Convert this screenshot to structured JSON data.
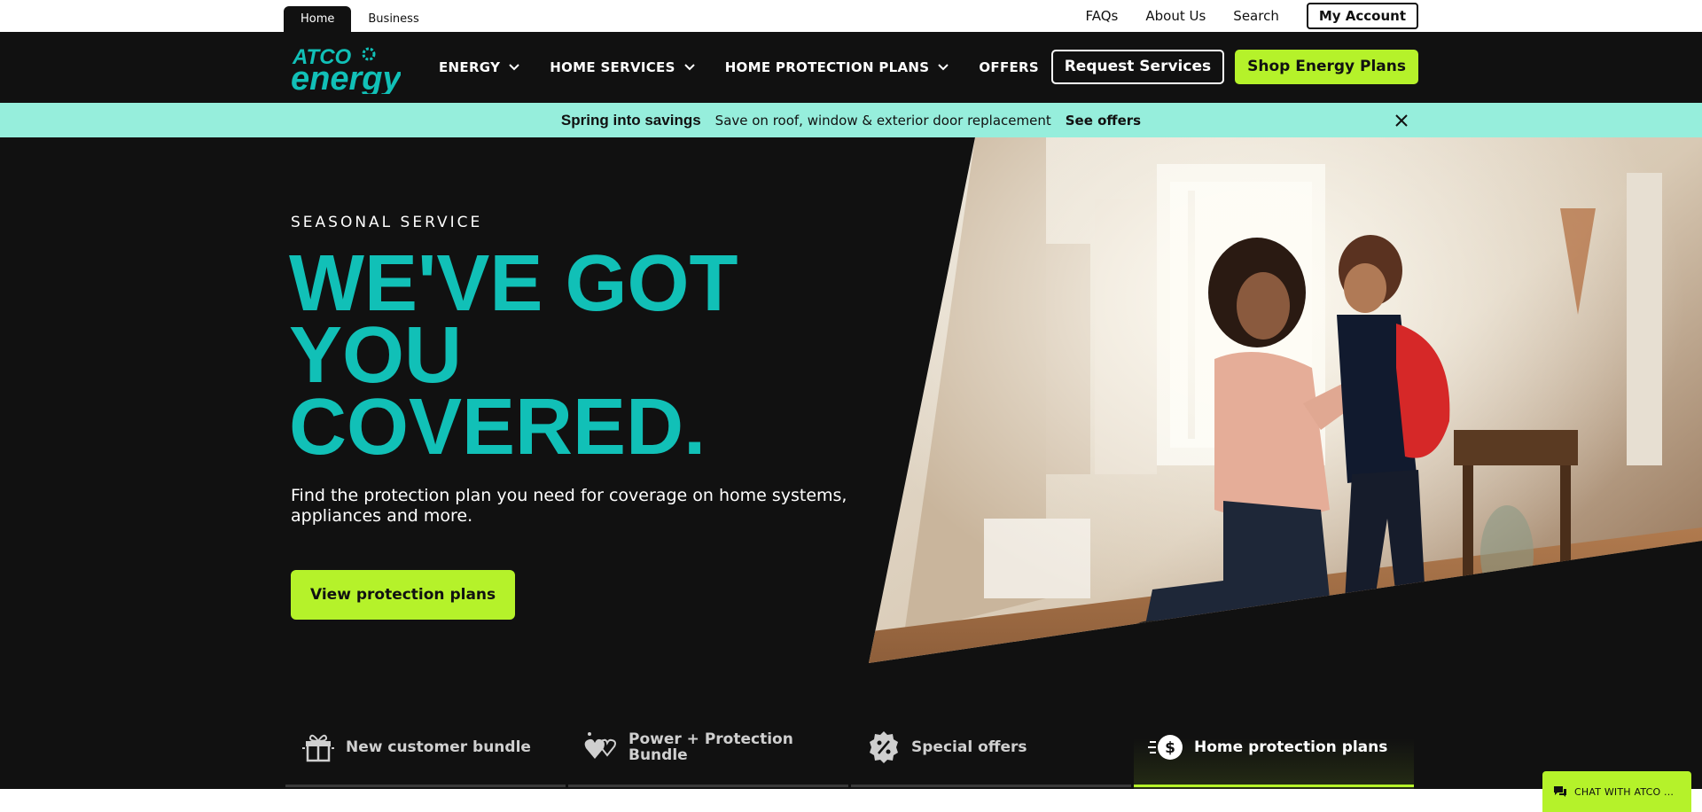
{
  "site_tabs": [
    {
      "label": "Home",
      "active": true
    },
    {
      "label": "Business",
      "active": false
    }
  ],
  "utility_links": [
    "FAQs",
    "About Us",
    "Search"
  ],
  "account_button": "My Account",
  "logo": {
    "line1": "ATCO",
    "line2": "energy"
  },
  "nav": {
    "items": [
      {
        "label": "ENERGY",
        "has_dropdown": true
      },
      {
        "label": "HOME SERVICES",
        "has_dropdown": true
      },
      {
        "label": "HOME PROTECTION PLANS",
        "has_dropdown": true
      },
      {
        "label": "OFFERS",
        "has_dropdown": false
      }
    ],
    "request_button": "Request Services",
    "shop_button": "Shop Energy Plans"
  },
  "promo": {
    "title": "Spring into savings",
    "text": "Save on roof, window & exterior door replacement",
    "link": "See offers",
    "close_icon": "close-icon"
  },
  "hero": {
    "eyebrow": "SEASONAL SERVICE",
    "headline": [
      "WE'VE GOT",
      "YOU",
      "COVERED."
    ],
    "subtitle": "Find the protection plan you need for coverage on home systems, appliances and more.",
    "cta": "View protection plans"
  },
  "feature_tabs": [
    {
      "label": "New customer bundle",
      "icon": "gift-icon",
      "active": false
    },
    {
      "label": "Power + Protection Bundle",
      "icon": "hearts-icon",
      "active": false
    },
    {
      "label": "Special offers",
      "icon": "percent-badge-icon",
      "active": false
    },
    {
      "label": "Home protection plans",
      "icon": "dollar-speed-icon",
      "active": true
    }
  ],
  "chat": {
    "label": "CHAT WITH ATCO ...",
    "icon": "chat-icon"
  },
  "colors": {
    "accent_teal": "#11c0b7",
    "accent_lime": "#b5f22a",
    "promo_bg": "#96eedc",
    "dark_bg": "#111111"
  }
}
